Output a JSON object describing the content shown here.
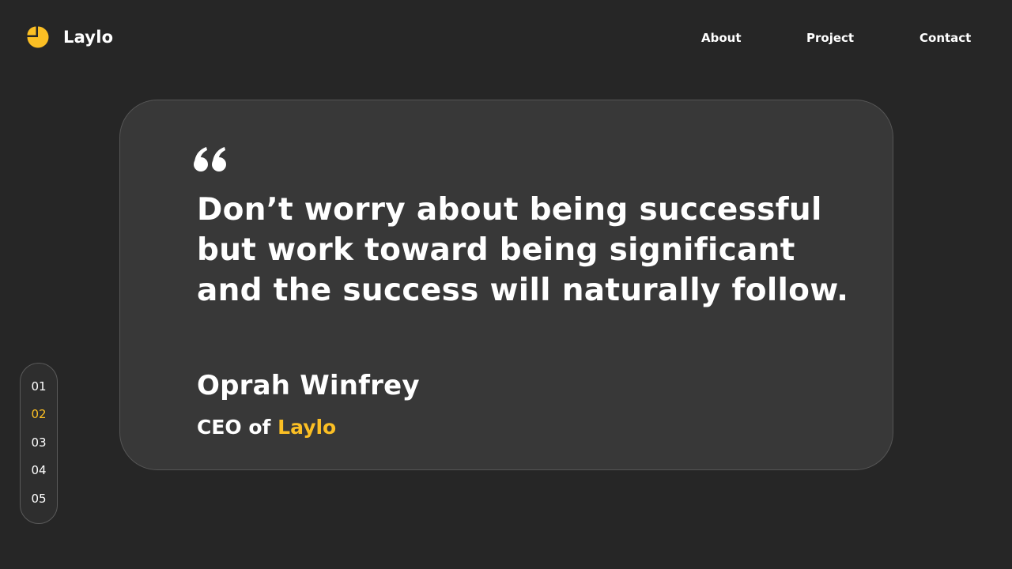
{
  "brand": {
    "name": "Laylo",
    "accent_color": "#fbbf24",
    "logo_icon": "pie-logo-icon"
  },
  "nav": {
    "items": [
      {
        "label": "About"
      },
      {
        "label": "Project"
      },
      {
        "label": "Contact"
      }
    ]
  },
  "testimonial": {
    "quote_icon": "quote-icon",
    "quote_lines": [
      "Don’t worry about being successful",
      "but work toward being significant",
      "and the success will naturally follow."
    ],
    "author": "Oprah Winfrey",
    "role_prefix": "CEO of",
    "role_company": "Laylo"
  },
  "pager": {
    "items": [
      "01",
      "02",
      "03",
      "04",
      "05"
    ],
    "active": "02"
  },
  "colors": {
    "background": "#262626",
    "card": "#383838"
  }
}
